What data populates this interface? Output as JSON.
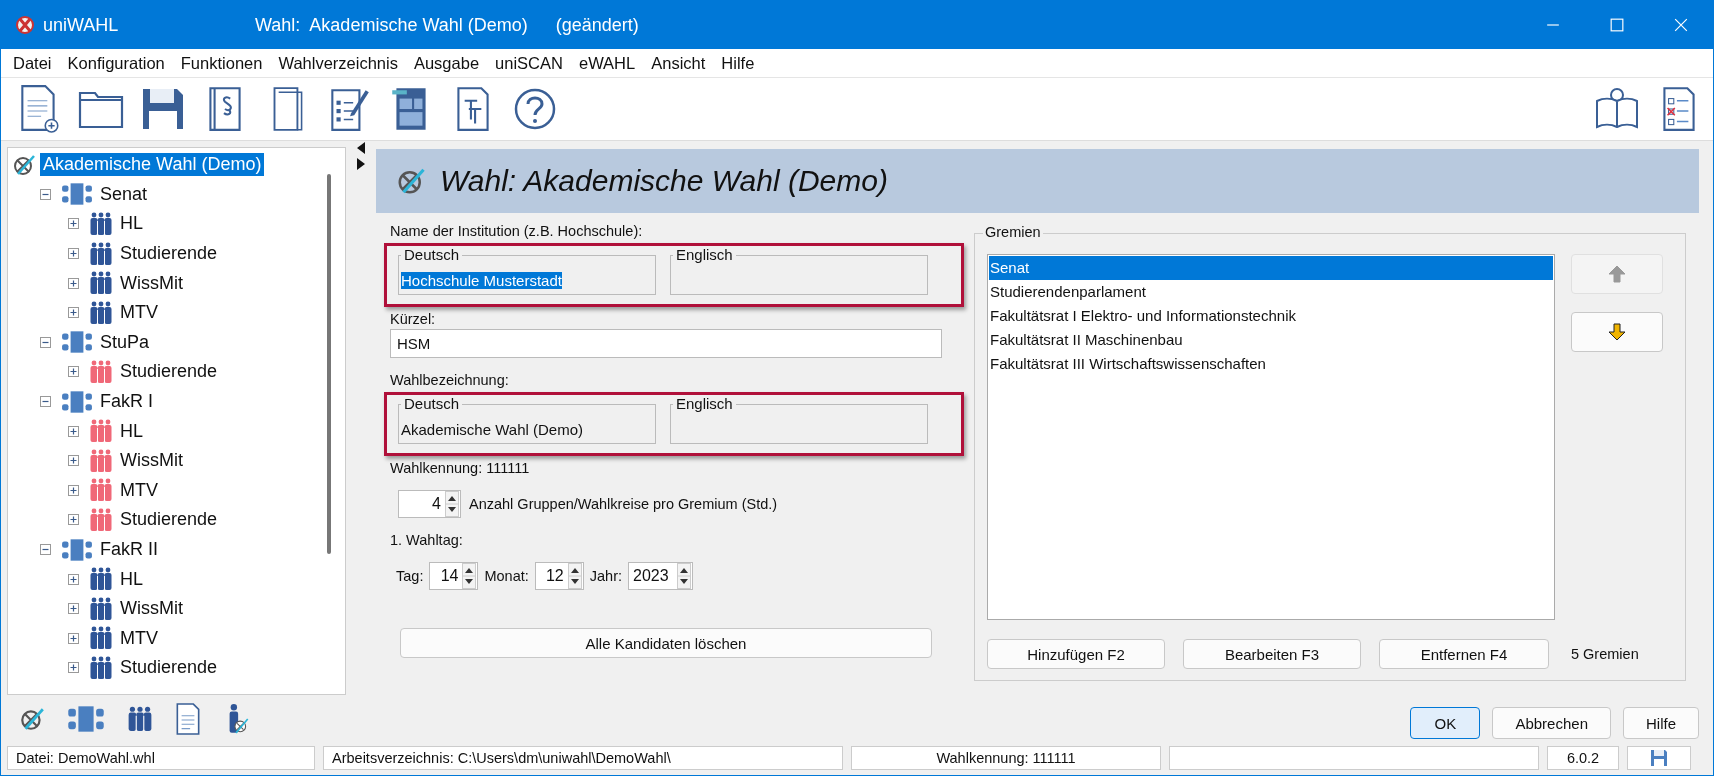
{
  "window": {
    "app_name": "uniWAHL",
    "title": "Wahl:  Akademische Wahl (Demo)",
    "modified": "(geändert)"
  },
  "menu": [
    "Datei",
    "Konfiguration",
    "Funktionen",
    "Wahlverzeichnis",
    "Ausgabe",
    "uniSCAN",
    "eWAHL",
    "Ansicht",
    "Hilfe"
  ],
  "tree": {
    "items": [
      {
        "label": "Akademische Wahl (Demo)",
        "kind": "election",
        "selected": true,
        "children": [
          {
            "label": "Senat",
            "kind": "body",
            "selected": false,
            "expanded": true,
            "children": [
              {
                "label": "HL",
                "kind": "group",
                "color": "#2f5597",
                "selected": false,
                "expanded": false
              },
              {
                "label": "Studierende",
                "kind": "group",
                "color": "#2f5597",
                "selected": false,
                "expanded": false
              },
              {
                "label": "WissMit",
                "kind": "group",
                "color": "#2f5597",
                "selected": false,
                "expanded": false
              },
              {
                "label": "MTV",
                "kind": "group",
                "color": "#2f5597",
                "selected": false,
                "expanded": false
              }
            ]
          },
          {
            "label": "StuPa",
            "kind": "body",
            "selected": false,
            "expanded": true,
            "children": [
              {
                "label": "Studierende",
                "kind": "group",
                "color": "#f06878",
                "selected": false,
                "expanded": false
              }
            ]
          },
          {
            "label": "FakR I",
            "kind": "body",
            "selected": false,
            "expanded": true,
            "children": [
              {
                "label": "HL",
                "kind": "group",
                "color": "#f06878",
                "selected": false,
                "expanded": false
              },
              {
                "label": "WissMit",
                "kind": "group",
                "color": "#f06878",
                "selected": false,
                "expanded": false
              },
              {
                "label": "MTV",
                "kind": "group",
                "color": "#f06878",
                "selected": false,
                "expanded": false
              },
              {
                "label": "Studierende",
                "kind": "group",
                "color": "#f06878",
                "selected": false,
                "expanded": false
              }
            ]
          },
          {
            "label": "FakR II",
            "kind": "body",
            "selected": false,
            "expanded": true,
            "children": [
              {
                "label": "HL",
                "kind": "group",
                "color": "#2f5597",
                "selected": false,
                "expanded": false
              },
              {
                "label": "WissMit",
                "kind": "group",
                "color": "#2f5597",
                "selected": false,
                "expanded": false
              },
              {
                "label": "MTV",
                "kind": "group",
                "color": "#2f5597",
                "selected": false,
                "expanded": false
              },
              {
                "label": "Studierende",
                "kind": "group",
                "color": "#2f5597",
                "selected": false,
                "expanded": false
              }
            ]
          }
        ]
      }
    ]
  },
  "header": {
    "title": "Wahl: Akademische Wahl (Demo)"
  },
  "form": {
    "institution_label": "Name der Institution (z.B. Hochschule):",
    "institution_fields": [
      {
        "legend": "Deutsch",
        "value": "Hochschule Musterstadt",
        "selected": true
      },
      {
        "legend": "Englisch"
      }
    ],
    "short_label": "Kürzel:",
    "short_value": "HSM",
    "election_label": "Wahlbezeichnung:",
    "election_fields": [
      {
        "legend": "Deutsch",
        "value": "Akademische Wahl (Demo)",
        "selected": false
      },
      {
        "legend": "Englisch"
      }
    ],
    "election_id": "Wahlkennung: 111111",
    "groups_count": "4",
    "groups_label": "Anzahl Gruppen/Wahlkreise pro Gremium (Std.)",
    "date_label": "1. Wahltag:",
    "date_fields": [
      {
        "label": "Tag:",
        "value": "14"
      },
      {
        "label": "Monat:",
        "value": "12"
      },
      {
        "label": "Jahr:",
        "value": "2023"
      }
    ],
    "clear_button": "Alle Kandidaten löschen"
  },
  "gremien": {
    "legend": "Gremien",
    "items": [
      {
        "label": "Senat",
        "selected": true
      },
      {
        "label": "Studierendenparlament",
        "selected": false
      },
      {
        "label": "Fakultätsrat I Elektro- und Informationstechnik",
        "selected": false
      },
      {
        "label": "Fakultätsrat II Maschinenbau",
        "selected": false
      },
      {
        "label": "Fakultätsrat III Wirtschaftswissenschaften",
        "selected": false
      }
    ],
    "move_up": {
      "disabled": true
    },
    "move_down": {
      "disabled": false
    },
    "buttons": [
      "Hinzufügen F2",
      "Bearbeiten F3",
      "Entfernen F4"
    ],
    "count": "5 Gremien"
  },
  "dialog_buttons": [
    {
      "label": "OK",
      "default": true
    },
    {
      "label": "Abbrechen",
      "default": false
    },
    {
      "label": "Hilfe",
      "default": false
    }
  ],
  "status_bar": [
    "Datei: DemoWahl.whl",
    "Arbeitsverzeichnis: C:\\Users\\dm\\uniwahl\\DemoWahl\\",
    "Wahlkennung: 111111",
    "6.0.2"
  ]
}
